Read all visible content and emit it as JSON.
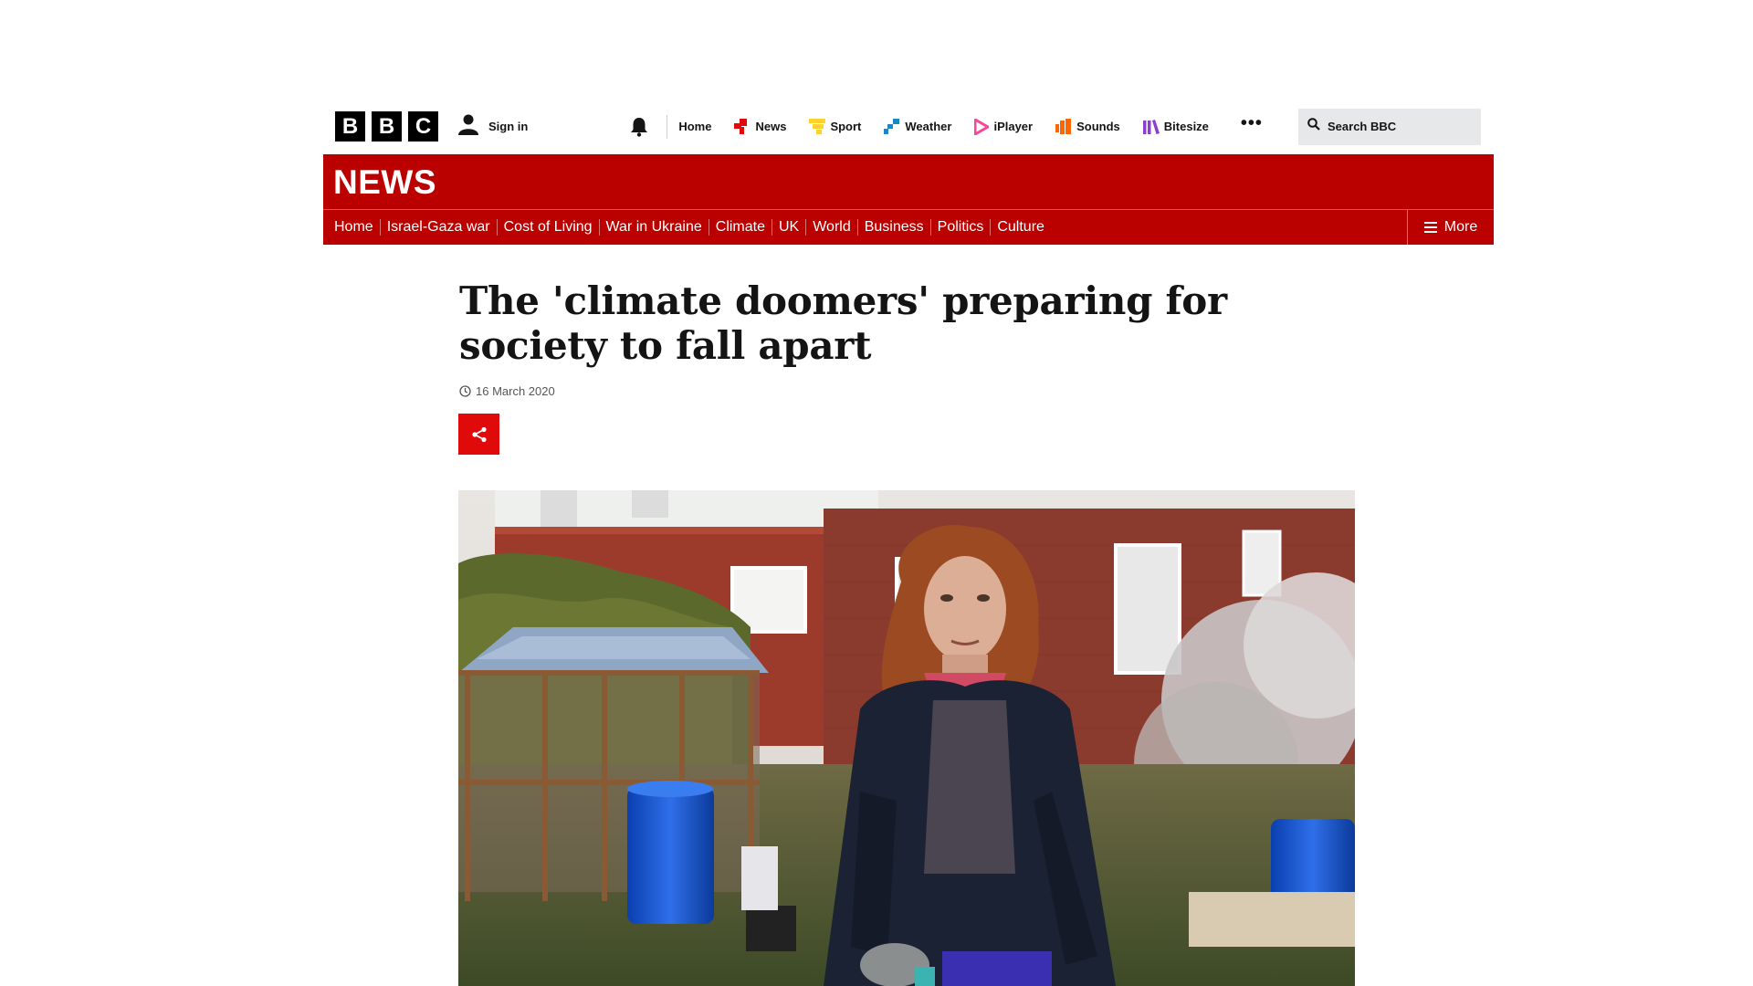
{
  "global_nav": {
    "logo_letters": [
      "B",
      "B",
      "C"
    ],
    "signin_label": "Sign in",
    "items": [
      {
        "label": "Home",
        "icon": "none",
        "color": ""
      },
      {
        "label": "News",
        "icon": "news-icon",
        "color": "#e10a0a"
      },
      {
        "label": "Sport",
        "icon": "sport-icon",
        "color": "#ffd230"
      },
      {
        "label": "Weather",
        "icon": "weather-icon",
        "color": "#1b86c6"
      },
      {
        "label": "iPlayer",
        "icon": "iplayer-icon",
        "color": "#f54997"
      },
      {
        "label": "Sounds",
        "icon": "sounds-icon",
        "color": "#ff6600"
      },
      {
        "label": "Bitesize",
        "icon": "bitesize-icon",
        "color": "#8b3fcc"
      }
    ],
    "more_label": "•••",
    "search_label": "Search BBC"
  },
  "masthead": {
    "title": "NEWS",
    "brand_color": "#bb0000",
    "sections": [
      "Home",
      "Israel-Gaza war",
      "Cost of Living",
      "War in Ukraine",
      "Climate",
      "UK",
      "World",
      "Business",
      "Politics",
      "Culture"
    ],
    "more_label": "More"
  },
  "article": {
    "headline": "The 'climate doomers' preparing for society to fall apart",
    "date": "16 March 2020",
    "share_color": "#e10a0a",
    "hero_image": "photo-woman-in-garden-with-greenhouse"
  }
}
